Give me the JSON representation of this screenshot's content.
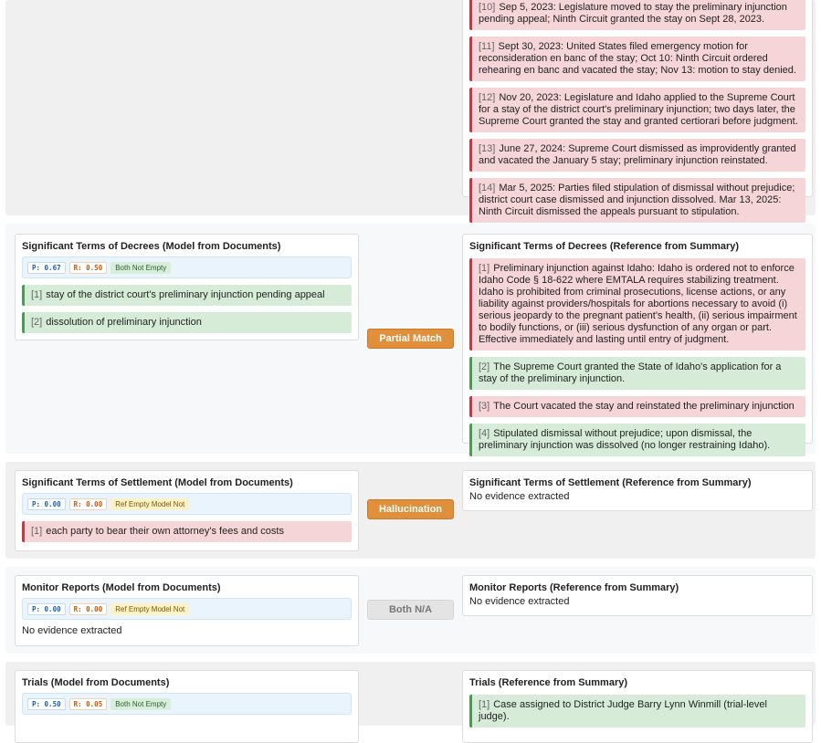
{
  "top": {
    "right_items": [
      {
        "num": "[10]",
        "text": "Sep 5, 2023: Legislature moved to stay the preliminary injunction pending appeal; Ninth Circuit granted the stay on Sept 28, 2023."
      },
      {
        "num": "[11]",
        "text": "Sept 30, 2023: United States filed emergency motion for reconsideration en banc of the stay; Oct 10: Ninth Circuit ordered rehearing en banc and vacated the stay; Nov 13: motion to stay denied."
      },
      {
        "num": "[12]",
        "text": "Nov 20, 2023: Legislature and Idaho applied to the Supreme Court for a stay of the district court's preliminary injunction; two days later, the Supreme Court granted the stay and granted certiorari before judgment."
      },
      {
        "num": "[13]",
        "text": "June 27, 2024: Supreme Court dismissed as improvidently granted and vacated the January 5 stay; preliminary injunction reinstated."
      },
      {
        "num": "[14]",
        "text": "Mar 5, 2025: Parties filed stipulation of dismissal without prejudice; district court case dismissed and injunction dissolved. Mar 13, 2025: Ninth Circuit dismissed the appeals pursuant to stipulation."
      }
    ]
  },
  "decrees": {
    "left_title": "Significant Terms of Decrees (Model from Documents)",
    "p": "P: 0.67",
    "r": "R: 0.50",
    "tag": "Both Not Empty",
    "left_items": [
      {
        "num": "[1]",
        "text": "stay of the district court's preliminary injunction pending appeal"
      },
      {
        "num": "[2]",
        "text": "dissolution of preliminary injunction"
      }
    ],
    "verdict": "Partial Match",
    "right_title": "Significant Terms of Decrees (Reference from Summary)",
    "right_items": [
      {
        "num": "[1]",
        "text": "Preliminary injunction against Idaho: Idaho is ordered not to enforce Idaho Code § 18-622 where EMTALA requires stabilizing treatment. Idaho is prohibited from criminal prosecutions, license actions, or any liability against providers/hospitals for abortions necessary to avoid (i) serious jeopardy to the pregnant patient's health, (ii) serious impairment to bodily functions, or (iii) serious dysfunction of any organ or part. Effective immediately and lasting until entry of judgment.",
        "color": "red"
      },
      {
        "num": "[2]",
        "text": "The Supreme Court granted the State of Idaho's application for a stay of the preliminary injunction.",
        "color": "green"
      },
      {
        "num": "[3]",
        "text": "The Court vacated the stay and reinstated the preliminary injunction",
        "color": "red"
      },
      {
        "num": "[4]",
        "text": "Stipulated dismissal without prejudice; upon dismissal, the preliminary injunction was dissolved (no longer restraining Idaho).",
        "color": "green"
      }
    ]
  },
  "settlement": {
    "left_title": "Significant Terms of Settlement (Model from Documents)",
    "p": "P: 0.00",
    "r": "R: 0.00",
    "tag": "Ref Empty Model Not",
    "left_items": [
      {
        "num": "[1]",
        "text": "each party to bear their own attorney's fees and costs"
      }
    ],
    "verdict": "Hallucination",
    "right_title": "Significant Terms of Settlement (Reference from Summary)",
    "right_empty": "No evidence extracted"
  },
  "monitor": {
    "left_title": "Monitor Reports (Model from Documents)",
    "p": "P: 0.00",
    "r": "R: 0.00",
    "tag": "Ref Empty Model Not",
    "left_empty": "No evidence extracted",
    "verdict": "Both N/A",
    "right_title": "Monitor Reports (Reference from Summary)",
    "right_empty": "No evidence extracted"
  },
  "trials": {
    "left_title": "Trials (Model from Documents)",
    "p": "P: 0.50",
    "r": "R: 0.05",
    "tag": "Both Not Empty",
    "right_title": "Trials (Reference from Summary)",
    "right_items": [
      {
        "num": "[1]",
        "text": "Case assigned to District Judge Barry Lynn Winmill (trial-level judge)."
      }
    ]
  },
  "colors": {
    "match_green": "#d6ecd8",
    "mismatch_red": "#f6d5d9",
    "verdict_orange": "#e08f3a",
    "metric_blue": "#eaf4fd"
  }
}
